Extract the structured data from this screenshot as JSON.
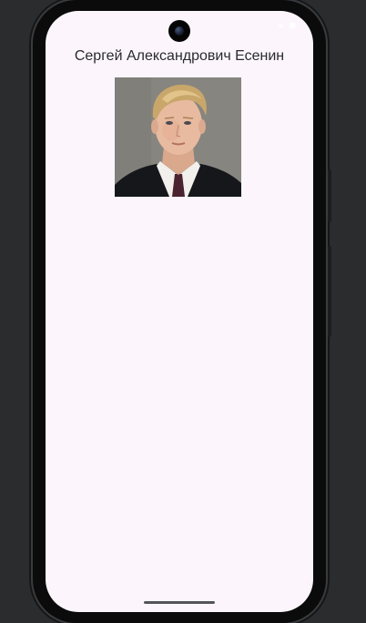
{
  "screen": {
    "title": "Сергей Александрович Есенин"
  },
  "portrait": {
    "subject": "portrait-photo"
  },
  "colors": {
    "background": "#fcf6fc",
    "title_text": "#2a2a2e",
    "device_frame": "#0b0b0b"
  }
}
